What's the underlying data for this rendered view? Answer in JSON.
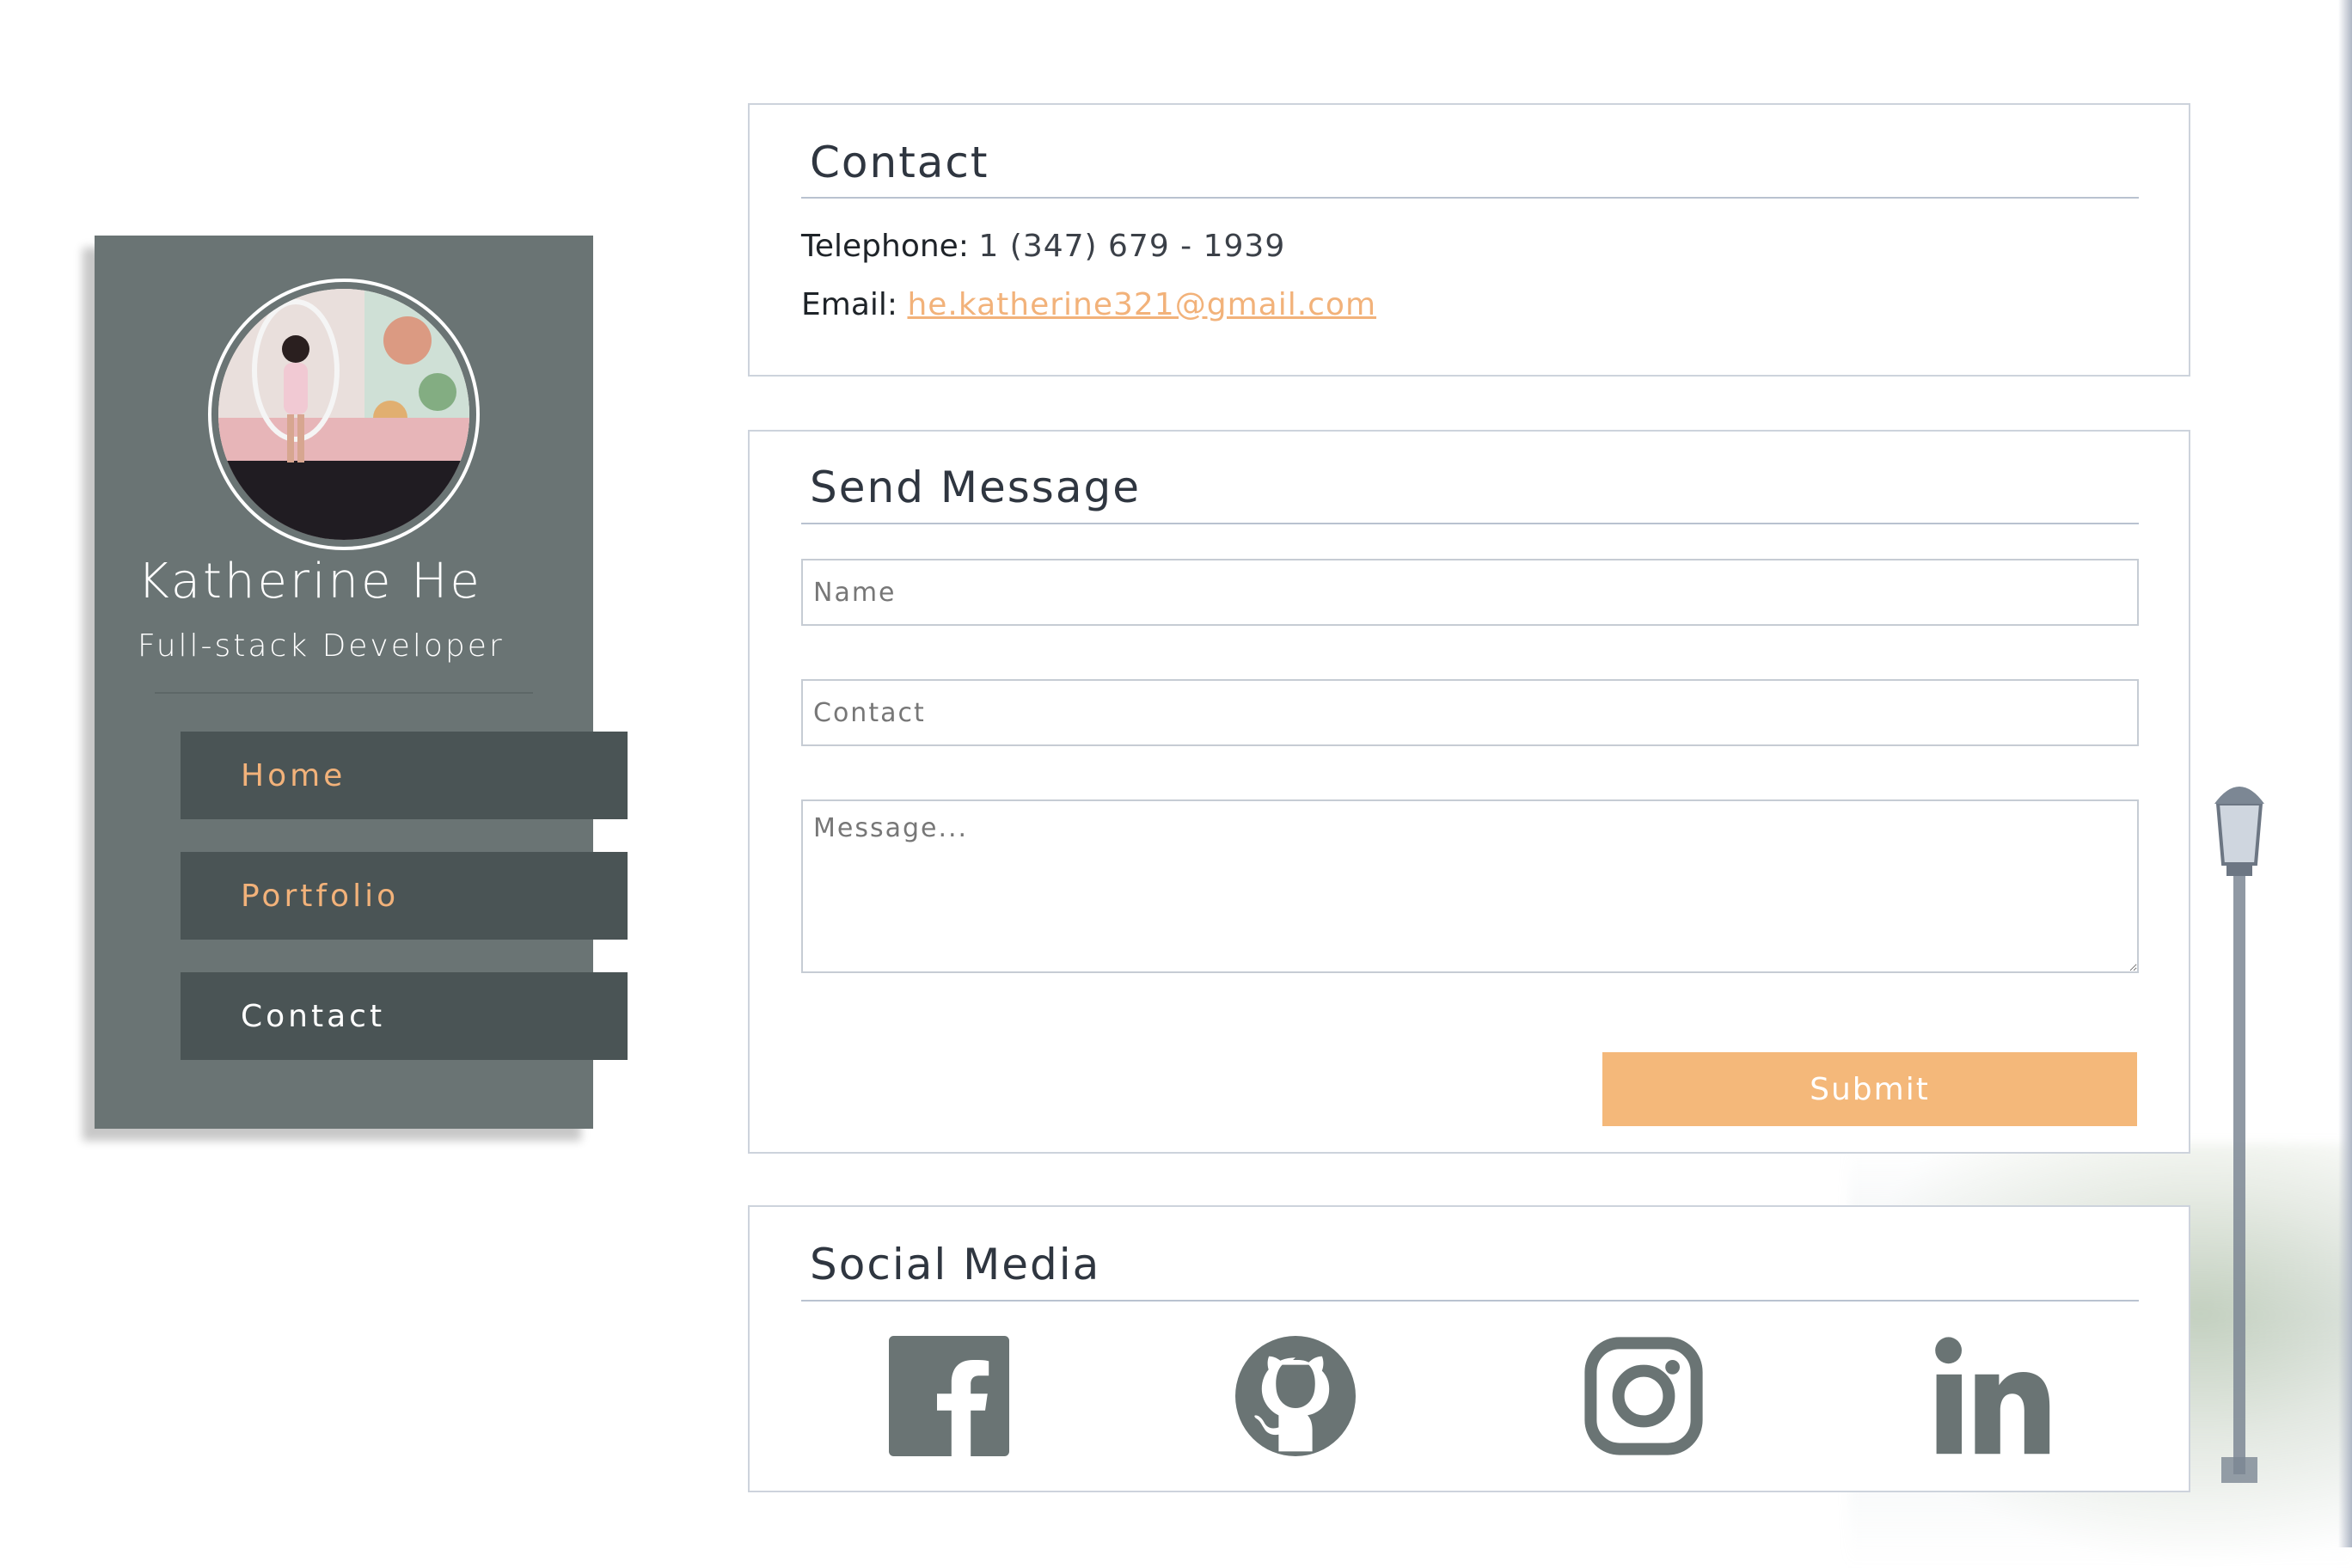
{
  "profile": {
    "name": "Katherine He",
    "title": "Full-stack Developer"
  },
  "nav": {
    "items": [
      {
        "label": "Home",
        "active": false
      },
      {
        "label": "Portfolio",
        "active": false
      },
      {
        "label": "Contact",
        "active": true
      }
    ]
  },
  "contact_section": {
    "heading": "Contact",
    "telephone_label": "Telephone:",
    "telephone_value": "1 (347) 679 - 1939",
    "email_label": "Email:",
    "email_value": "he.katherine321@gmail.com"
  },
  "message_section": {
    "heading": "Send Message",
    "name_placeholder": "Name",
    "contact_placeholder": "Contact",
    "message_placeholder": "Message...",
    "submit_label": "Submit"
  },
  "social_section": {
    "heading": "Social Media",
    "icons": [
      "facebook-icon",
      "github-icon",
      "instagram-icon",
      "linkedin-icon"
    ]
  },
  "colors": {
    "sidebar": "#6a7474",
    "nav_item": "#4a5455",
    "accent": "#f2b27a",
    "submit": "#f4b87a",
    "icon": "#6a7474"
  }
}
